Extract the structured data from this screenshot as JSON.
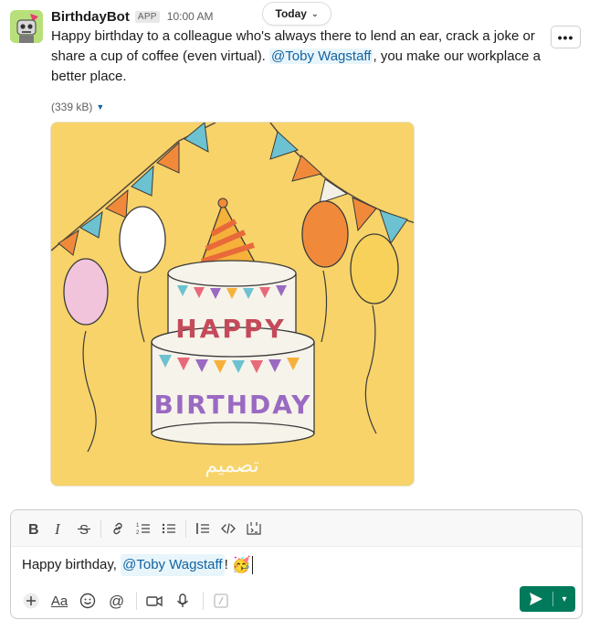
{
  "message": {
    "bot_name": "BirthdayBot",
    "app_badge": "APP",
    "time": "10:00 AM",
    "text_part1": "Happy birthday to a colleague who's always there to lend an ear, crack a joke or share a cup of coffee (even virtual). ",
    "mention": "@Toby Wagstaff",
    "text_part2": ", you make our workplace a better place.",
    "more_label": "•••",
    "file_size": "(339 kB)",
    "image": {
      "banner_text": "HAPPY",
      "cake_text": "BIRTHDAY",
      "signature": "تصميم"
    }
  },
  "date_divider": {
    "label": "Today"
  },
  "composer": {
    "text_prefix": "Happy birthday, ",
    "mention": "@Toby Wagstaff",
    "text_suffix": "!",
    "emoji": "🥳",
    "font_btn": "Aa"
  },
  "colors": {
    "accent": "#1264a3",
    "send": "#007a5a",
    "image_bg": "#f7d36a"
  }
}
